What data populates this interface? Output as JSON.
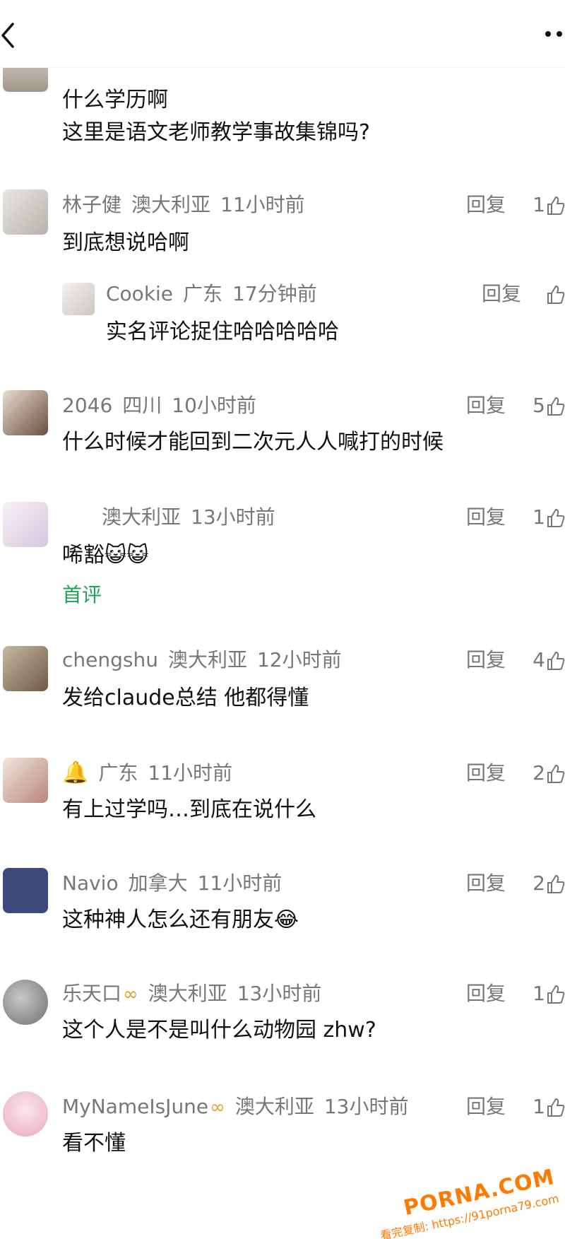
{
  "header": {
    "back_icon": "chevron-left-icon",
    "more_icon": "more-dots-icon"
  },
  "reply_label": "回复",
  "comments": [
    {
      "lines": [
        "什么学历啊",
        "这里是语文老师教学事故集锦吗?"
      ]
    },
    {
      "user": "林子健",
      "location": "澳大利亚",
      "time": "11小时前",
      "likes": "1",
      "text": "到底想说哈啊",
      "reply": {
        "user": "Cookie",
        "location": "广东",
        "time": "17分钟前",
        "text": "实名评论捉住哈哈哈哈哈"
      }
    },
    {
      "user": "2046",
      "location": "四川",
      "time": "10小时前",
      "likes": "5",
      "text": "什么时候才能回到二次元人人喊打的时候"
    },
    {
      "user": "",
      "location": "澳大利亚",
      "time": "13小时前",
      "likes": "1",
      "text": "唏豁😺😺",
      "tag": "首评"
    },
    {
      "user": "chengshu",
      "location": "澳大利亚",
      "time": "12小时前",
      "likes": "4",
      "text": "发给claude总结 他都得懂"
    },
    {
      "user": "🔔",
      "location": "广东",
      "time": "11小时前",
      "likes": "2",
      "text": "有上过学吗…到底在说什么"
    },
    {
      "user": "Navio",
      "location": "加拿大",
      "time": "11小时前",
      "likes": "2",
      "text": "这种神人怎么还有朋友😂"
    },
    {
      "user": "乐天口",
      "location": "澳大利亚",
      "time": "13小时前",
      "likes": "1",
      "text": "这个人是不是叫什么动物园 zhw?"
    },
    {
      "user": "MyNameIsJune",
      "location": "澳大利亚",
      "time": "13小时前",
      "likes": "1",
      "text": "看不懂"
    }
  ],
  "watermark": {
    "line1": "PORNA.COM",
    "line2": "看完复制: https://91porna79.com"
  },
  "colors": {
    "meta_text": "#777777",
    "tag_green": "#1ea35a",
    "watermark_orange": "#ff7a00"
  }
}
